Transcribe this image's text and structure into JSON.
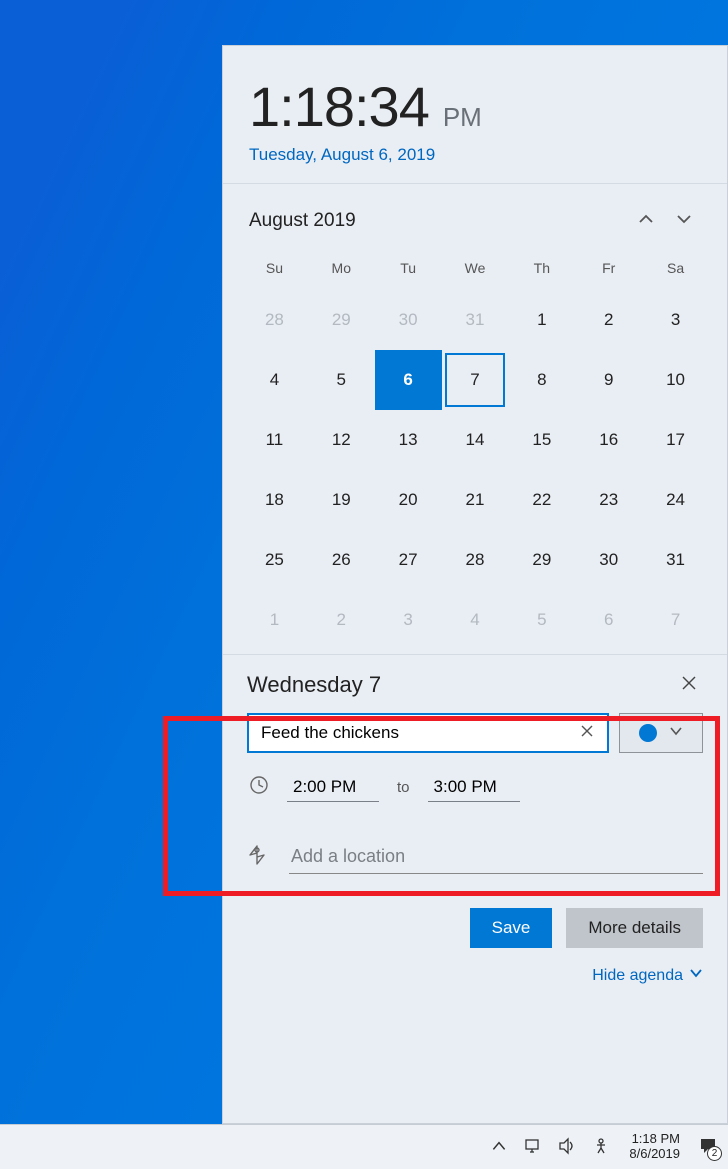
{
  "clock": {
    "time": "1:18:34",
    "ampm": "PM",
    "date": "Tuesday, August 6, 2019"
  },
  "calendar": {
    "month_label": "August 2019",
    "weekday_labels": [
      "Su",
      "Mo",
      "Tu",
      "We",
      "Th",
      "Fr",
      "Sa"
    ],
    "weeks": [
      [
        {
          "n": "28",
          "out": true
        },
        {
          "n": "29",
          "out": true
        },
        {
          "n": "30",
          "out": true
        },
        {
          "n": "31",
          "out": true
        },
        {
          "n": "1"
        },
        {
          "n": "2"
        },
        {
          "n": "3"
        }
      ],
      [
        {
          "n": "4"
        },
        {
          "n": "5"
        },
        {
          "n": "6",
          "today": true
        },
        {
          "n": "7",
          "selected": true
        },
        {
          "n": "8"
        },
        {
          "n": "9"
        },
        {
          "n": "10"
        }
      ],
      [
        {
          "n": "11"
        },
        {
          "n": "12"
        },
        {
          "n": "13"
        },
        {
          "n": "14"
        },
        {
          "n": "15"
        },
        {
          "n": "16"
        },
        {
          "n": "17"
        }
      ],
      [
        {
          "n": "18"
        },
        {
          "n": "19"
        },
        {
          "n": "20"
        },
        {
          "n": "21"
        },
        {
          "n": "22"
        },
        {
          "n": "23"
        },
        {
          "n": "24"
        }
      ],
      [
        {
          "n": "25"
        },
        {
          "n": "26"
        },
        {
          "n": "27"
        },
        {
          "n": "28"
        },
        {
          "n": "29"
        },
        {
          "n": "30"
        },
        {
          "n": "31"
        }
      ],
      [
        {
          "n": "1",
          "out": true
        },
        {
          "n": "2",
          "out": true
        },
        {
          "n": "3",
          "out": true
        },
        {
          "n": "4",
          "out": true
        },
        {
          "n": "5",
          "out": true
        },
        {
          "n": "6",
          "out": true
        },
        {
          "n": "7",
          "out": true
        }
      ]
    ]
  },
  "event": {
    "day_label": "Wednesday 7",
    "title_value": "Feed the chickens",
    "start_time": "2:00 PM",
    "to_label": "to",
    "end_time": "3:00 PM",
    "calendar_color": "#0078d4"
  },
  "location": {
    "placeholder": "Add a location"
  },
  "buttons": {
    "save": "Save",
    "more": "More details"
  },
  "hide_agenda": "Hide agenda",
  "taskbar": {
    "time": "1:18 PM",
    "date": "8/6/2019",
    "notification_count": "2"
  }
}
